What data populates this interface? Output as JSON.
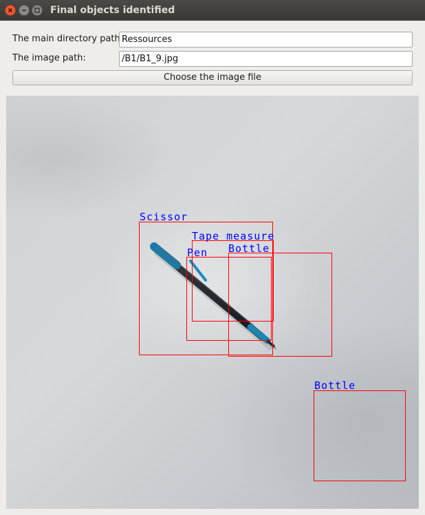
{
  "window": {
    "title": "Final objects identified",
    "controls": [
      "close-icon",
      "minimize-icon",
      "maximize-icon"
    ]
  },
  "form": {
    "main_dir_label": "The main directory path:",
    "main_dir_value": "Ressources",
    "image_path_label": "The image path:",
    "image_path_value": "/B1/B1_9.jpg",
    "choose_button": "Choose the image file"
  },
  "detections": [
    {
      "label": "Scissor"
    },
    {
      "label": "Tape measure"
    },
    {
      "label": "Pen"
    },
    {
      "label": "Bottle"
    },
    {
      "label": "Bottle"
    }
  ],
  "colors": {
    "box": "#ff0000",
    "label": "#0000ff",
    "close": "#ef5b32"
  }
}
